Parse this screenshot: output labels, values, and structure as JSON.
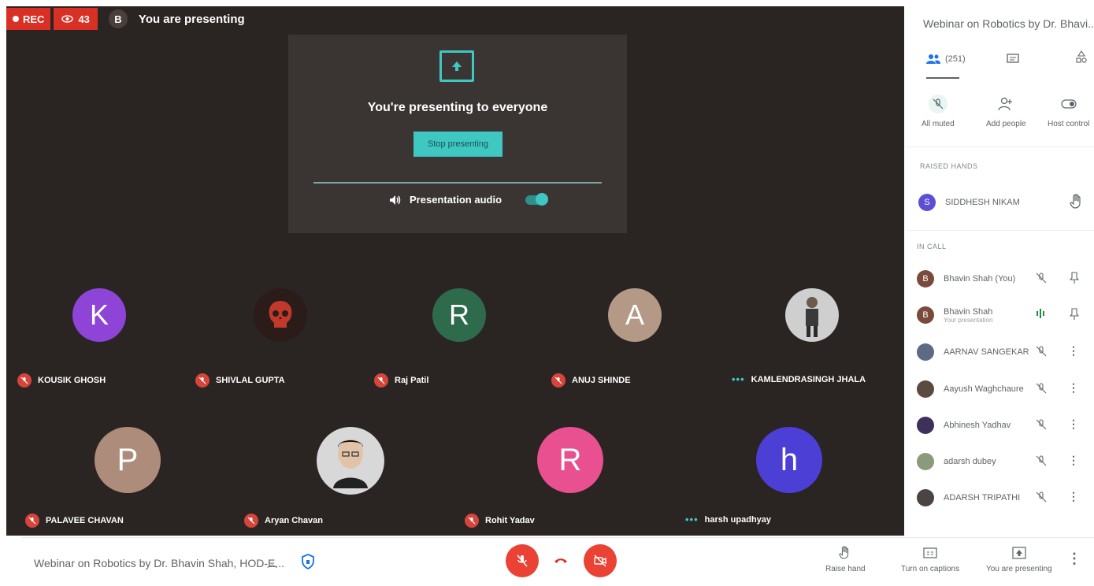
{
  "status": {
    "rec_label": "REC",
    "viewers": "43",
    "presenter_initial": "B",
    "presenting_text": "You are presenting"
  },
  "present": {
    "title": "You're presenting to everyone",
    "stop_label": "Stop presenting",
    "audio_label": "Presentation audio"
  },
  "tiles": [
    {
      "name": "KOUSIK GHOSH",
      "initial": "K",
      "color": "#8e44d6",
      "status": "muted"
    },
    {
      "name": "SHIVLAL GUPTA",
      "initial": "",
      "color": "#2b1c1a",
      "status": "muted",
      "picture": "red-skull-avatar"
    },
    {
      "name": "Raj Patil",
      "initial": "R",
      "color": "#2e6b4d",
      "status": "muted"
    },
    {
      "name": "ANUJ SHINDE",
      "initial": "A",
      "color": "#b49a86",
      "status": "muted"
    },
    {
      "name": "KAMLENDRASINGH JHALA",
      "initial": "",
      "color": "#cfcfcf",
      "status": "speaking",
      "picture": "person-photo"
    },
    {
      "name": "PALAVEE CHAVAN",
      "initial": "P",
      "color": "#ad8c7b",
      "status": "muted"
    },
    {
      "name": "Aryan Chavan",
      "initial": "",
      "color": "#d8d8d8",
      "status": "muted",
      "picture": "person-photo"
    },
    {
      "name": "Rohit Yadav",
      "initial": "R",
      "color": "#e9508f",
      "status": "muted"
    },
    {
      "name": "harsh upadhyay",
      "initial": "h",
      "color": "#4b3fd6",
      "status": "speaking"
    }
  ],
  "bottom": {
    "meeting_title": "Webinar on Robotics by Dr. Bhavin Shah, HOD-E...",
    "raise_hand": "Raise hand",
    "captions": "Turn on captions",
    "presenting": "You are presenting"
  },
  "panel": {
    "title": "Webinar on Robotics by Dr. Bhavi...",
    "people_count": "(251)",
    "actions": {
      "all_muted": "All muted",
      "add_people": "Add people",
      "host_controls": "Host control"
    },
    "raised_hands_label": "RAISED HANDS",
    "raised_hand": {
      "initial": "S",
      "name": "SIDDHESH NIKAM",
      "color": "#5c4fd6"
    },
    "in_call_label": "IN CALL",
    "participants": [
      {
        "initial": "B",
        "name": "Bhavin Shah (You)",
        "sub": "",
        "color": "#7a4b3b",
        "mic": "muted",
        "action": "pin"
      },
      {
        "initial": "B",
        "name": "Bhavin Shah",
        "sub": "Your presentation",
        "color": "#7a4b3b",
        "mic": "speaking",
        "action": "pin"
      },
      {
        "initial": "",
        "name": "AARNAV SANGEKAR",
        "sub": "",
        "color": "#5b6b86",
        "mic": "muted",
        "action": "more"
      },
      {
        "initial": "",
        "name": "Aayush Waghchaure",
        "sub": "",
        "color": "#5a4a3f",
        "mic": "muted",
        "action": "more"
      },
      {
        "initial": "",
        "name": "Abhinesh Yadhav",
        "sub": "",
        "color": "#3e2f5b",
        "mic": "muted",
        "action": "more"
      },
      {
        "initial": "",
        "name": "adarsh dubey",
        "sub": "",
        "color": "#8a9a7b",
        "mic": "muted",
        "action": "more"
      },
      {
        "initial": "",
        "name": "ADARSH TRIPATHI",
        "sub": "",
        "color": "#4a4443",
        "mic": "muted",
        "action": "more"
      }
    ]
  }
}
